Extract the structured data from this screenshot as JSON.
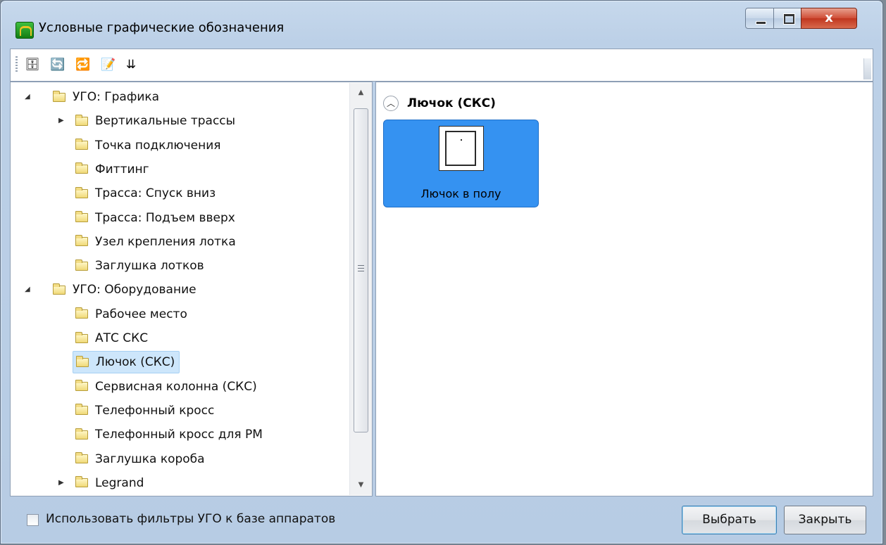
{
  "window": {
    "title": "Условные графические обозначения",
    "close_glyph": "x"
  },
  "toolbar": {
    "buttons": [
      {
        "name": "database-icon",
        "glyph": "🗄"
      },
      {
        "name": "refresh-icon",
        "glyph": "🔄"
      },
      {
        "name": "sync-icon",
        "glyph": "🔁"
      },
      {
        "name": "edit-icon",
        "glyph": "📝"
      },
      {
        "name": "sort-icon",
        "glyph": "⇊"
      }
    ]
  },
  "tree": {
    "items": [
      {
        "label": "УГО: Графика",
        "level": 0,
        "expander": "expanded"
      },
      {
        "label": "Вертикальные трассы",
        "level": 1,
        "expander": "collapsed"
      },
      {
        "label": "Точка подключения",
        "level": 1,
        "expander": "none"
      },
      {
        "label": "Фиттинг",
        "level": 1,
        "expander": "none"
      },
      {
        "label": "Трасса: Спуск вниз",
        "level": 1,
        "expander": "none"
      },
      {
        "label": "Трасса: Подъем вверх",
        "level": 1,
        "expander": "none"
      },
      {
        "label": "Узел крепления лотка",
        "level": 1,
        "expander": "none"
      },
      {
        "label": "Заглушка лотков",
        "level": 1,
        "expander": "none"
      },
      {
        "label": "УГО: Оборудование",
        "level": 0,
        "expander": "expanded"
      },
      {
        "label": "Рабочее место",
        "level": 1,
        "expander": "none"
      },
      {
        "label": "АТС СКС",
        "level": 1,
        "expander": "none"
      },
      {
        "label": "Лючок (СКС)",
        "level": 1,
        "expander": "none",
        "selected": true
      },
      {
        "label": "Сервисная колонна (СКС)",
        "level": 1,
        "expander": "none"
      },
      {
        "label": "Телефонный кросс",
        "level": 1,
        "expander": "none"
      },
      {
        "label": "Телефонный кросс для РМ",
        "level": 1,
        "expander": "none"
      },
      {
        "label": "Заглушка короба",
        "level": 1,
        "expander": "none"
      },
      {
        "label": "Legrand",
        "level": 1,
        "expander": "collapsed"
      }
    ]
  },
  "content": {
    "group_title": "Лючок (СКС)",
    "tiles": [
      {
        "label": "Лючок в полу",
        "icon": "floor-hatch-icon"
      }
    ]
  },
  "footer": {
    "checkbox_label": "Использовать фильтры УГО к базе аппаратов",
    "checkbox_checked": false,
    "ok_label": "Выбрать",
    "close_label": "Закрыть"
  },
  "colors": {
    "selection_bg": "#cde6fb",
    "tile_bg": "#3592f1",
    "window_frame": "#bcd0e7"
  }
}
